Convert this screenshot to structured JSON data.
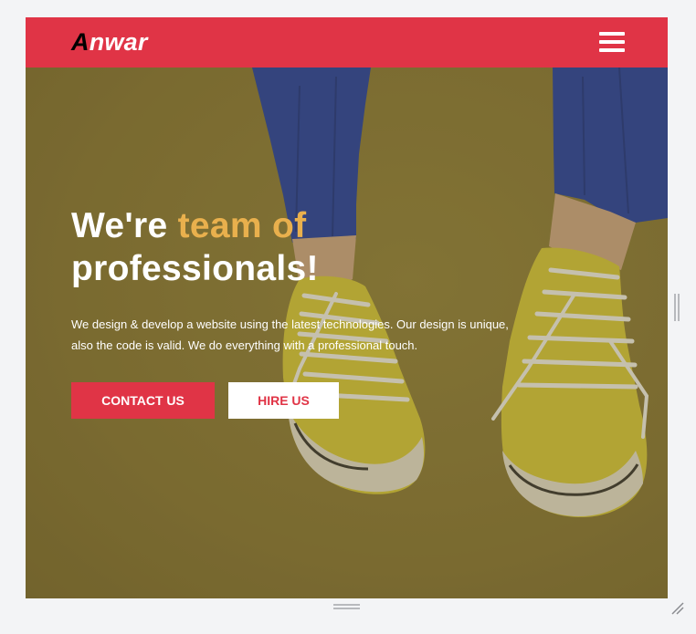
{
  "navbar": {
    "logo_first": "A",
    "logo_rest": "nwar",
    "menu_icon": "hamburger-menu-icon",
    "color": "#e03446"
  },
  "hero": {
    "headline_part1": "We're ",
    "headline_highlight": "team of",
    "headline_part2": "professionals!",
    "description": "We design & develop a website using the latest technologies. Our design is unique, also the code is valid. We do everything with a professional touch.",
    "primary_button": "CONTACT US",
    "secondary_button": "HIRE US",
    "highlight_color": "#e9b04d",
    "background_color": "#857435"
  },
  "frame": {
    "vertical_resize_icon": "vertical-resize-handle-icon",
    "horizontal_resize_icon": "horizontal-resize-handle-icon",
    "corner_resize_icon": "resize-grip-icon"
  }
}
